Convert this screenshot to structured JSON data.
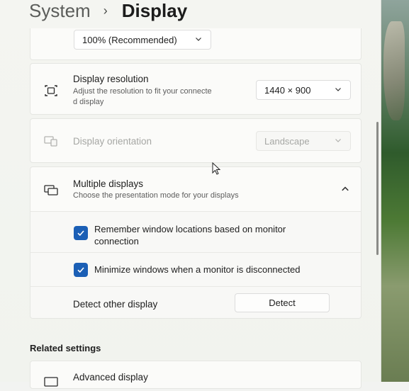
{
  "breadcrumb": {
    "parent": "System",
    "separator": "›",
    "current": "Display"
  },
  "scale": {
    "value": "100% (Recommended)"
  },
  "resolution": {
    "title": "Display resolution",
    "subtitle_line1": "Adjust the resolution to fit your connecte",
    "subtitle_line2": "d display",
    "value": "1440 × 900"
  },
  "orientation": {
    "title": "Display orientation",
    "value": "Landscape"
  },
  "multiple_displays": {
    "title": "Multiple displays",
    "subtitle": "Choose the presentation mode for your displays",
    "remember_line1": "Remember window locations based on monitor",
    "remember_line2": "connection",
    "minimize_label": "Minimize windows when a monitor is disconnected",
    "detect_label": "Detect other display",
    "detect_button": "Detect"
  },
  "related": {
    "heading": "Related settings",
    "advanced_display": "Advanced display"
  },
  "colors": {
    "accent": "#1b5fb5"
  }
}
